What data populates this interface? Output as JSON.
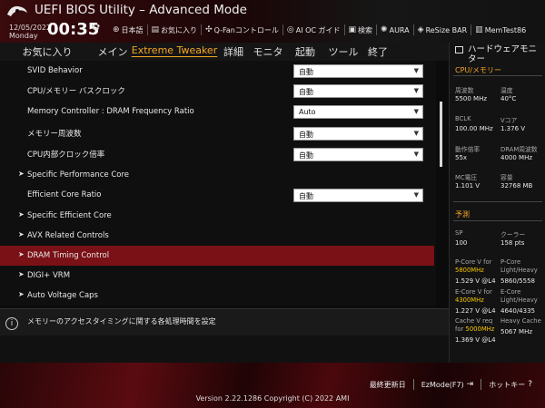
{
  "header": {
    "title": "UEFI BIOS Utility – Advanced Mode",
    "date": "12/05/2022",
    "weekday": "Monday",
    "time": "00:35",
    "toolbar": [
      {
        "icon": "globe-icon",
        "label": "日本語"
      },
      {
        "icon": "bookmark-icon",
        "label": "お気に入り"
      },
      {
        "icon": "fan-icon",
        "label": "Q-Fanコントロール"
      },
      {
        "icon": "ai-oc-icon",
        "label": "AI OC ガイド"
      },
      {
        "icon": "search-icon",
        "label": "検索"
      },
      {
        "icon": "aura-icon",
        "label": "AURA"
      },
      {
        "icon": "resize-bar-icon",
        "label": "ReSize BAR"
      },
      {
        "icon": "memtest-icon",
        "label": "MemTest86"
      }
    ]
  },
  "menu": {
    "tabs": [
      "お気に入り",
      "メイン",
      "Extreme Tweaker",
      "詳細",
      "モニタ",
      "起動",
      "ツール",
      "終了"
    ],
    "active": "Extreme Tweaker"
  },
  "settings": [
    {
      "label": "SVID Behavior",
      "value": "自動",
      "submenu": false
    },
    {
      "label": "CPU/メモリー バスクロック",
      "value": "自動",
      "submenu": false
    },
    {
      "label": "Memory Controller : DRAM Frequency Ratio",
      "value": "Auto",
      "submenu": false
    },
    {
      "label": "メモリー周波数",
      "value": "自動",
      "submenu": false
    },
    {
      "label": "CPU内部クロック倍率",
      "value": "自動",
      "submenu": false
    },
    {
      "label": "Specific Performance Core",
      "value": null,
      "submenu": true
    },
    {
      "label": "Efficient Core Ratio",
      "value": "自動",
      "submenu": false
    },
    {
      "label": "Specific Efficient Core",
      "value": null,
      "submenu": true
    },
    {
      "label": "AVX Related Controls",
      "value": null,
      "submenu": true
    },
    {
      "label": "DRAM Timing Control",
      "value": null,
      "submenu": true,
      "selected": true
    },
    {
      "label": "DIGI+ VRM",
      "value": null,
      "submenu": true
    },
    {
      "label": "Auto Voltage Caps",
      "value": null,
      "submenu": true
    }
  ],
  "help": {
    "text": "メモリーのアクセスタイミングに関する各処理時間を設定"
  },
  "hw_monitor": {
    "title": "ハードウェアモニター",
    "cpu_section": "CPU/メモリー",
    "cpu": {
      "freq_label": "周波数",
      "freq_val": "5500 MHz",
      "temp_label": "温度",
      "temp_val": "40°C",
      "bclk_label": "BCLK",
      "bclk_val": "100.00 MHz",
      "vcore_label": "Vコア",
      "vcore_val": "1.376 V",
      "ratio_label": "動作倍率",
      "ratio_val": "55x",
      "dram_freq_label": "DRAM周波数",
      "dram_freq_val": "4000 MHz",
      "mc_volt_label": "MC電圧",
      "mc_volt_val": "1.101 V",
      "capacity_label": "容量",
      "capacity_val": "32768 MB"
    },
    "predict_section": "予測",
    "predict": {
      "sp_label": "SP",
      "sp_val": "100",
      "cooler_label": "クーラー",
      "cooler_val": "158 pts",
      "pcore_label_a": "P-Core V for",
      "pcore_label_b": "5800MHz",
      "pcore_val": "1.529 V @L4",
      "pcore_light_label": "P-Core Light/Heavy",
      "pcore_light_val": "5860/5558",
      "ecore_label_a": "E-Core V for",
      "ecore_label_b": "4300MHz",
      "ecore_val": "1.227 V @L4",
      "ecore_light_label": "E-Core Light/Heavy",
      "ecore_light_val": "4640/4335",
      "cache_label_a": "Cache V req",
      "cache_label_b": "for ",
      "cache_label_c": "5000MHz",
      "cache_val": "1.369 V @L4",
      "cache_heavy_label": "Heavy Cache",
      "cache_heavy_val": "5067 MHz"
    }
  },
  "footer": {
    "last_modified": "最終更新日",
    "ezmode": "EzMode(F7)",
    "hotkeys": "ホットキー",
    "version": "Version 2.22.1286 Copyright (C) 2022 AMI"
  },
  "colors": {
    "accent": "#f5a623",
    "highlight_row": "#7a1116",
    "predict_highlight": "#f5c400"
  }
}
